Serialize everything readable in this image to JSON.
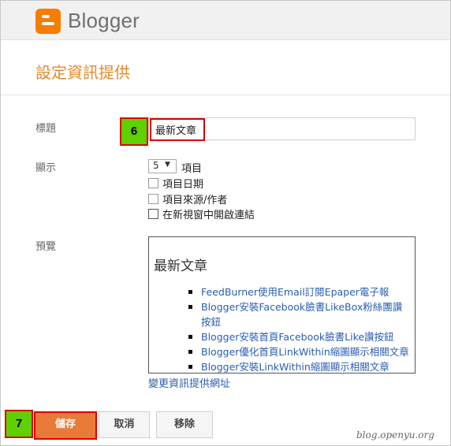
{
  "header": {
    "app_name": "Blogger",
    "logo_icon": "blogger-logo-icon",
    "logo_color": "#f57d00"
  },
  "page": {
    "title": "設定資訊提供"
  },
  "form": {
    "title_label": "標題",
    "title_value": "最新文章",
    "display_label": "顯示",
    "count_value": "5",
    "count_suffix": "項目",
    "options": [
      {
        "label": "項目日期",
        "checked": false
      },
      {
        "label": "項目來源/作者",
        "checked": false
      },
      {
        "label": "在新視窗中開啟連結",
        "checked": false
      }
    ],
    "preview_label": "預覽"
  },
  "preview": {
    "heading": "最新文章",
    "items": [
      "FeedBurner使用Email訂閱Epaper電子報",
      "Blogger安裝Facebook臉書LikeBox粉絲團讚按鈕",
      "Blogger安裝首頁Facebook臉書Like讚按鈕",
      "Blogger優化首頁LinkWithin縮圖顯示相關文章",
      "Blogger安裝LinkWithin縮圖顯示相關文章"
    ]
  },
  "change_link": "變更資訊提供網址",
  "buttons": {
    "save": "儲存",
    "cancel": "取消",
    "remove": "移除"
  },
  "annotations": {
    "step_title": "6",
    "step_save": "7",
    "badge_color": "#5fd000",
    "highlight_color": "#e00000"
  },
  "watermark": "blog.openyu.org"
}
